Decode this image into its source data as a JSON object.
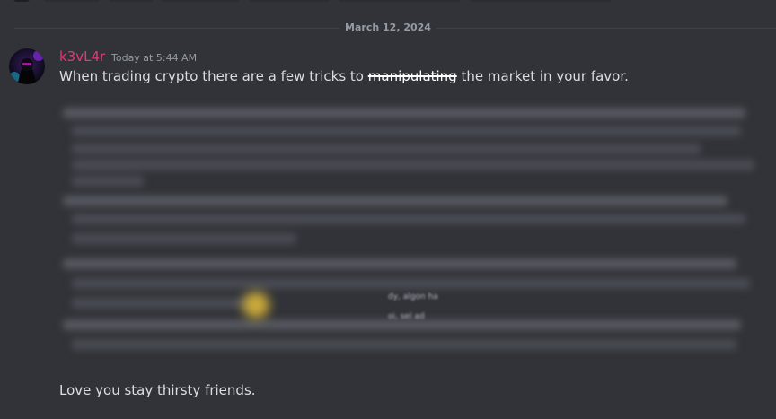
{
  "divider": {
    "date": "March 12, 2024"
  },
  "message": {
    "author": "k3vL4r",
    "timestamp": "Today at 5:44 AM",
    "line_start": "When trading crypto there are a few tricks to",
    "line_strike": "manipulating",
    "line_end": "the market in your favor.",
    "blurred_fragment_1": "dy, algon ha",
    "blurred_fragment_2": "oi, sel ad",
    "closing": "Love you stay thirsty friends."
  },
  "colors": {
    "background": "#313338",
    "username": "#e9357a",
    "text": "#dbdee1",
    "muted": "#949ba4"
  }
}
